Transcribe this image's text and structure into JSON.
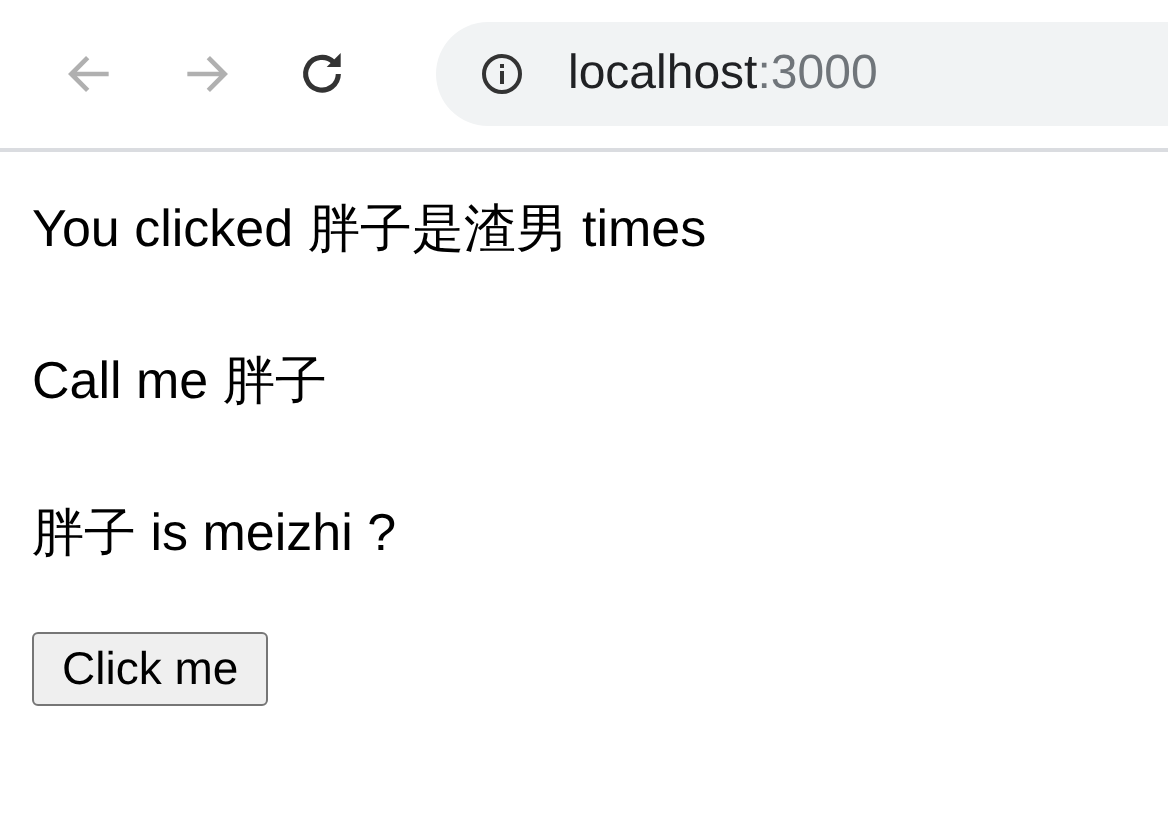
{
  "toolbar": {
    "nav": [
      {
        "kind": "back",
        "disabled": true
      },
      {
        "kind": "forward",
        "disabled": true
      },
      {
        "kind": "reload",
        "disabled": false
      }
    ],
    "address": {
      "host": "localhost",
      "port": ":3000"
    }
  },
  "paragraphs": [
    "You clicked 胖子是渣男 times",
    "Call me 胖子",
    "胖子 is meizhi ?"
  ],
  "button": "Click me"
}
